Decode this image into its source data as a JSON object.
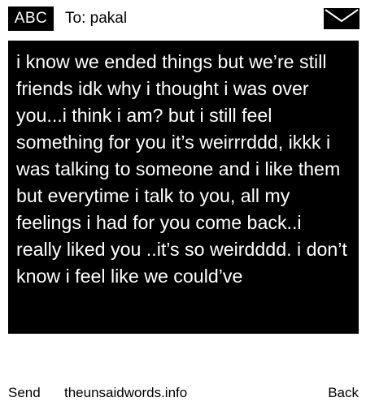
{
  "header": {
    "mode_badge": "ABC",
    "recipient": "To: pakal",
    "envelope_icon": "envelope-icon"
  },
  "message": {
    "text": "i know we ended things but we’re still friends idk why i thought i was over you...i think i am? but i still feel something for you it’s weirrrddd, ikkk i was talking to someone and i like them but everytime i talk to you, all my feelings i had for you come back..i really liked you ..it’s so weirdddd. i don’t know i feel like we could’ve"
  },
  "footer": {
    "send_label": "Send",
    "site_label": "theunsaidwords.info",
    "back_label": "Back"
  },
  "colors": {
    "background": "#ffffff",
    "foreground": "#000000",
    "message_text": "#ffffff"
  }
}
